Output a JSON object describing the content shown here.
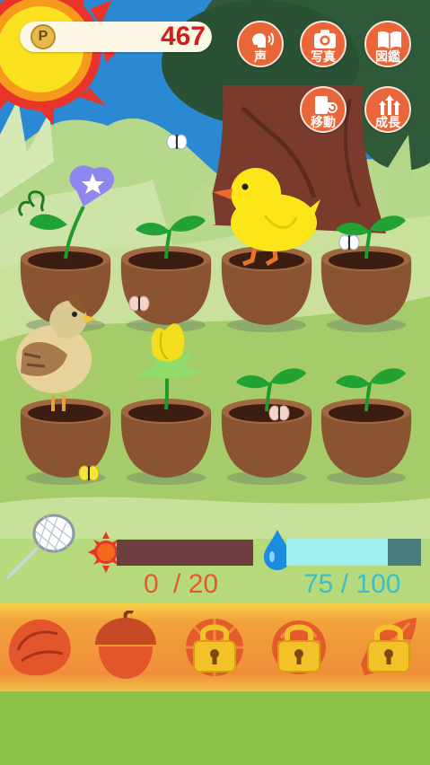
{
  "coins": {
    "value": "467",
    "icon": "P"
  },
  "menu": [
    {
      "id": "voice",
      "label": "声",
      "icon": "voice-icon"
    },
    {
      "id": "photo",
      "label": "写真",
      "icon": "camera-icon"
    },
    {
      "id": "book",
      "label": "図鑑",
      "icon": "book-icon"
    },
    {
      "id": "move",
      "label": "移動",
      "icon": "move-icon"
    },
    {
      "id": "growth",
      "label": "成長",
      "icon": "growth-arrows-icon"
    }
  ],
  "meters": {
    "sun": {
      "current": "0",
      "separator": "/",
      "max": "20",
      "fraction": 0.0,
      "color": "#e45a28"
    },
    "water": {
      "current": "75",
      "separator": "/",
      "max": "100",
      "fraction": 0.75,
      "color": "#3bbfc7"
    }
  },
  "pots": [
    {
      "row": 1,
      "col": 1,
      "plant": "morning-glory"
    },
    {
      "row": 1,
      "col": 2,
      "plant": "sprout"
    },
    {
      "row": 1,
      "col": 3,
      "plant": "sprout-under-duck"
    },
    {
      "row": 1,
      "col": 4,
      "plant": "sprout"
    },
    {
      "row": 2,
      "col": 1,
      "plant": "sprout-under-mallard"
    },
    {
      "row": 2,
      "col": 2,
      "plant": "yellow-tulip"
    },
    {
      "row": 2,
      "col": 3,
      "plant": "sprout"
    },
    {
      "row": 2,
      "col": 4,
      "plant": "sprout"
    }
  ],
  "seeds": [
    {
      "name": "seed-1",
      "locked": false
    },
    {
      "name": "seed-acorn",
      "locked": false
    },
    {
      "name": "seed-3",
      "locked": true
    },
    {
      "name": "seed-4",
      "locked": true
    },
    {
      "name": "seed-5",
      "locked": true
    }
  ]
}
